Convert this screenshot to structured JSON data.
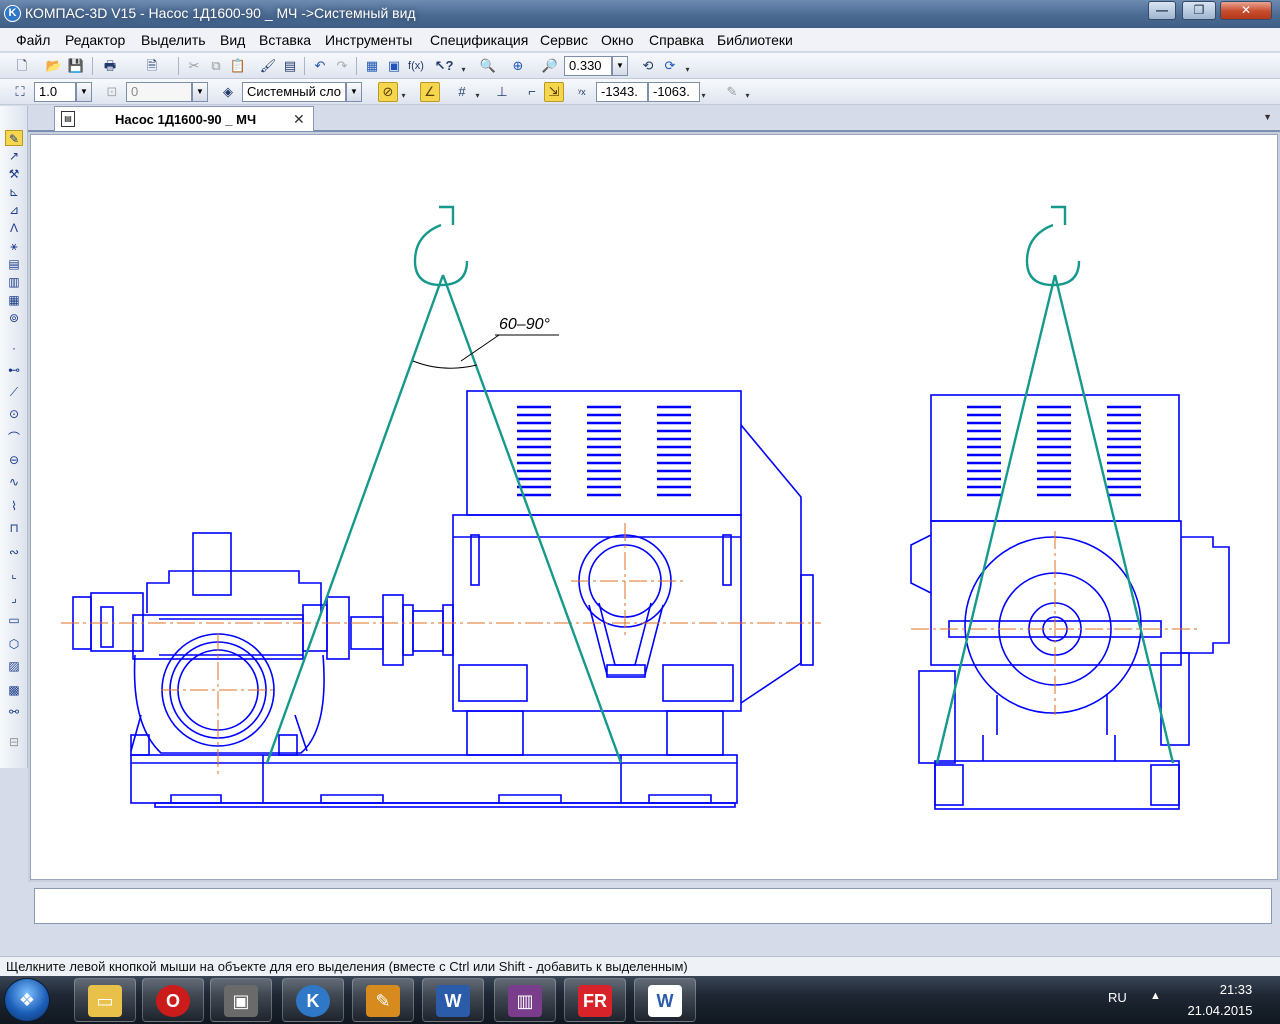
{
  "window": {
    "title": "КОМПАС-3D V15 - Насос 1Д1600-90 _ МЧ ->Системный вид",
    "app_icon": "K",
    "minimize": "—",
    "restore": "❐",
    "close": "✕"
  },
  "menu": {
    "items": [
      "Файл",
      "Редактор",
      "Выделить",
      "Вид",
      "Вставка",
      "Инструменты",
      "Спецификация",
      "Сервис",
      "Окно",
      "Справка",
      "Библиотеки"
    ]
  },
  "toolbar_standard": {
    "zoom_value": "0.330"
  },
  "toolbar_current": {
    "step_value": "1.0",
    "angle_value": "0",
    "layer_value": "Системный сло",
    "coord_x": "-1343.",
    "coord_y": "-1063."
  },
  "tabs": [
    {
      "label": "Насос 1Д1600-90 _ МЧ",
      "active": true
    }
  ],
  "drawing": {
    "angle_annotation": "60–90°",
    "colors": {
      "lines": "#0000ff",
      "slings": "#16998a",
      "axis": "#e07020",
      "bg": "#ffffff"
    }
  },
  "status": {
    "hint": "Щелкните левой кнопкой мыши на объекте для его выделения (вместе с Ctrl или Shift - добавить к выделенным)"
  },
  "taskbar": {
    "apps": [
      "folder-app",
      "opera-app",
      "computer-app",
      "kompas-app",
      "editor-app",
      "word-app",
      "winrar-app",
      "finereader-app",
      "word-doc-app"
    ],
    "lang": "RU",
    "time": "21:33",
    "date": "21.04.2015"
  }
}
